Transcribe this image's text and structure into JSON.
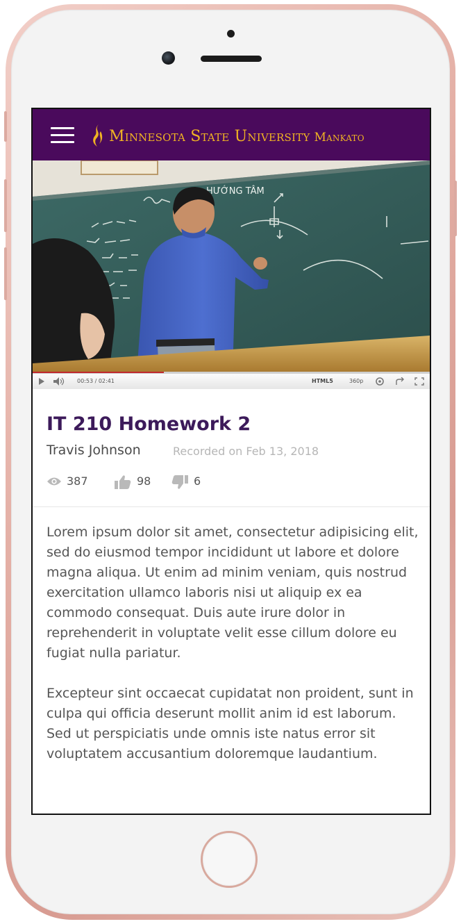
{
  "header": {
    "logo_main": "Minnesota State University",
    "logo_sub": "Mankato",
    "menu_icon": "hamburger-menu-icon"
  },
  "colors": {
    "header_bg": "#4a0a5c",
    "logo_gold": "#f0b323",
    "title": "#3c1a5a",
    "phone_rose_gold": "#e4b0a6"
  },
  "player": {
    "current_time": "00:53",
    "duration": "02:41",
    "time_display": "00:53 / 02:41",
    "format": "HTML5",
    "quality": "360p",
    "progress": 0.33,
    "board_text": "HƯỚNG TÂM"
  },
  "video": {
    "title": "IT 210 Homework 2",
    "author": "Travis Johnson",
    "recorded": "Recorded on Feb 13, 2018"
  },
  "stats": {
    "views": "387",
    "likes": "98",
    "dislikes": "6"
  },
  "description": {
    "paragraph_1": "Lorem ipsum dolor sit amet, consectetur adipisicing elit, sed do eiusmod tempor incididunt ut labore et dolore magna aliqua. Ut enim ad minim veniam, quis nostrud exercitation ullamco laboris nisi ut aliquip ex ea commodo consequat. Duis aute irure dolor in reprehenderit in voluptate velit esse cillum dolore eu fugiat nulla pariatur.",
    "paragraph_2": "Excepteur sint occaecat cupidatat non proident, sunt in culpa qui officia deserunt mollit anim id est laborum. Sed ut perspiciatis unde omnis iste natus error sit voluptatem accusantium doloremque laudantium."
  }
}
